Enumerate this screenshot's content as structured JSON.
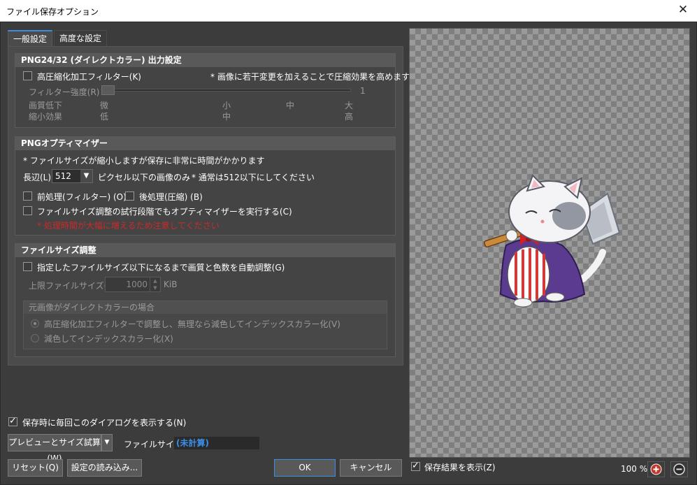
{
  "window": {
    "title": "ファイル保存オプション",
    "close_glyph": "✕"
  },
  "tabs": [
    {
      "label": "一般設定",
      "active": true
    },
    {
      "label": "高度な設定",
      "active": false
    }
  ],
  "png_output": {
    "header": "PNG24/32 (ダイレクトカラー) 出力設定",
    "checkbox_label": "高圧縮化加工フィルター(K)",
    "checkbox_checked": false,
    "note": "* 画像に若干変更を加えることで圧縮効果を高めます",
    "filter_label": "フィルター強度(R)",
    "filter_value": "1",
    "slider_level": 0,
    "quality_label": "画質低下",
    "quality_scale": [
      "微",
      "小",
      "中",
      "大"
    ],
    "effect_label": "縮小効果",
    "effect_scale": [
      "低",
      "中",
      "高"
    ]
  },
  "optimizer": {
    "header": "PNGオプティマイザー",
    "note": "* ファイルサイズが縮小しますが保存に非常に時間がかかります",
    "edge_label": "長辺(L)",
    "edge_value": "512",
    "edge_suffix": "ピクセル以下の画像のみ",
    "edge_note": "* 通常は512以下にしてください",
    "pre_label": "前処理(フィルター) (O)",
    "post_label": "後処理(圧縮) (B)",
    "trial_label": "ファイルサイズ調整の試行段階でもオプティマイザーを実行する(C)",
    "warning": "* 処理時間が大幅に増えるため注意してください"
  },
  "filesize": {
    "header": "ファイルサイズ調整",
    "auto_label": "指定したファイルサイズ以下になるまで画質と色数を自動調整(G)",
    "limit_label": "上限ファイルサイズ(J) :",
    "limit_value": "1000",
    "limit_unit": "KiB",
    "sub_header": "元画像がダイレクトカラーの場合",
    "radio1": "高圧縮化加工フィルターで調整し、無理なら減色してインデックスカラー化(V)",
    "radio2": "減色してインデックスカラー化(X)"
  },
  "footer": {
    "show_dialog_label": "保存時に毎回このダイアログを表示する(N)",
    "show_dialog_checked": true,
    "preview_button": "プレビューとサイズ試算(W)",
    "size_label": "ファイルサイズ :",
    "size_value": "(未計算)",
    "reset_button": "リセット(Q)",
    "load_button": "設定の読み込み...",
    "ok_button": "OK",
    "cancel_button": "キャンセル",
    "show_result_label": "保存結果を表示(Z)",
    "show_result_checked": true,
    "zoom_value": "100 %"
  },
  "icons": {
    "close": "close-icon",
    "zoom_in": "zoom-in-icon",
    "zoom_out": "zoom-out-icon",
    "dropdown": "chevron-down-icon"
  },
  "colors": {
    "accent": "#3a8ee6",
    "warning": "#cc2a2a",
    "zoom_in": "#c0392b"
  }
}
